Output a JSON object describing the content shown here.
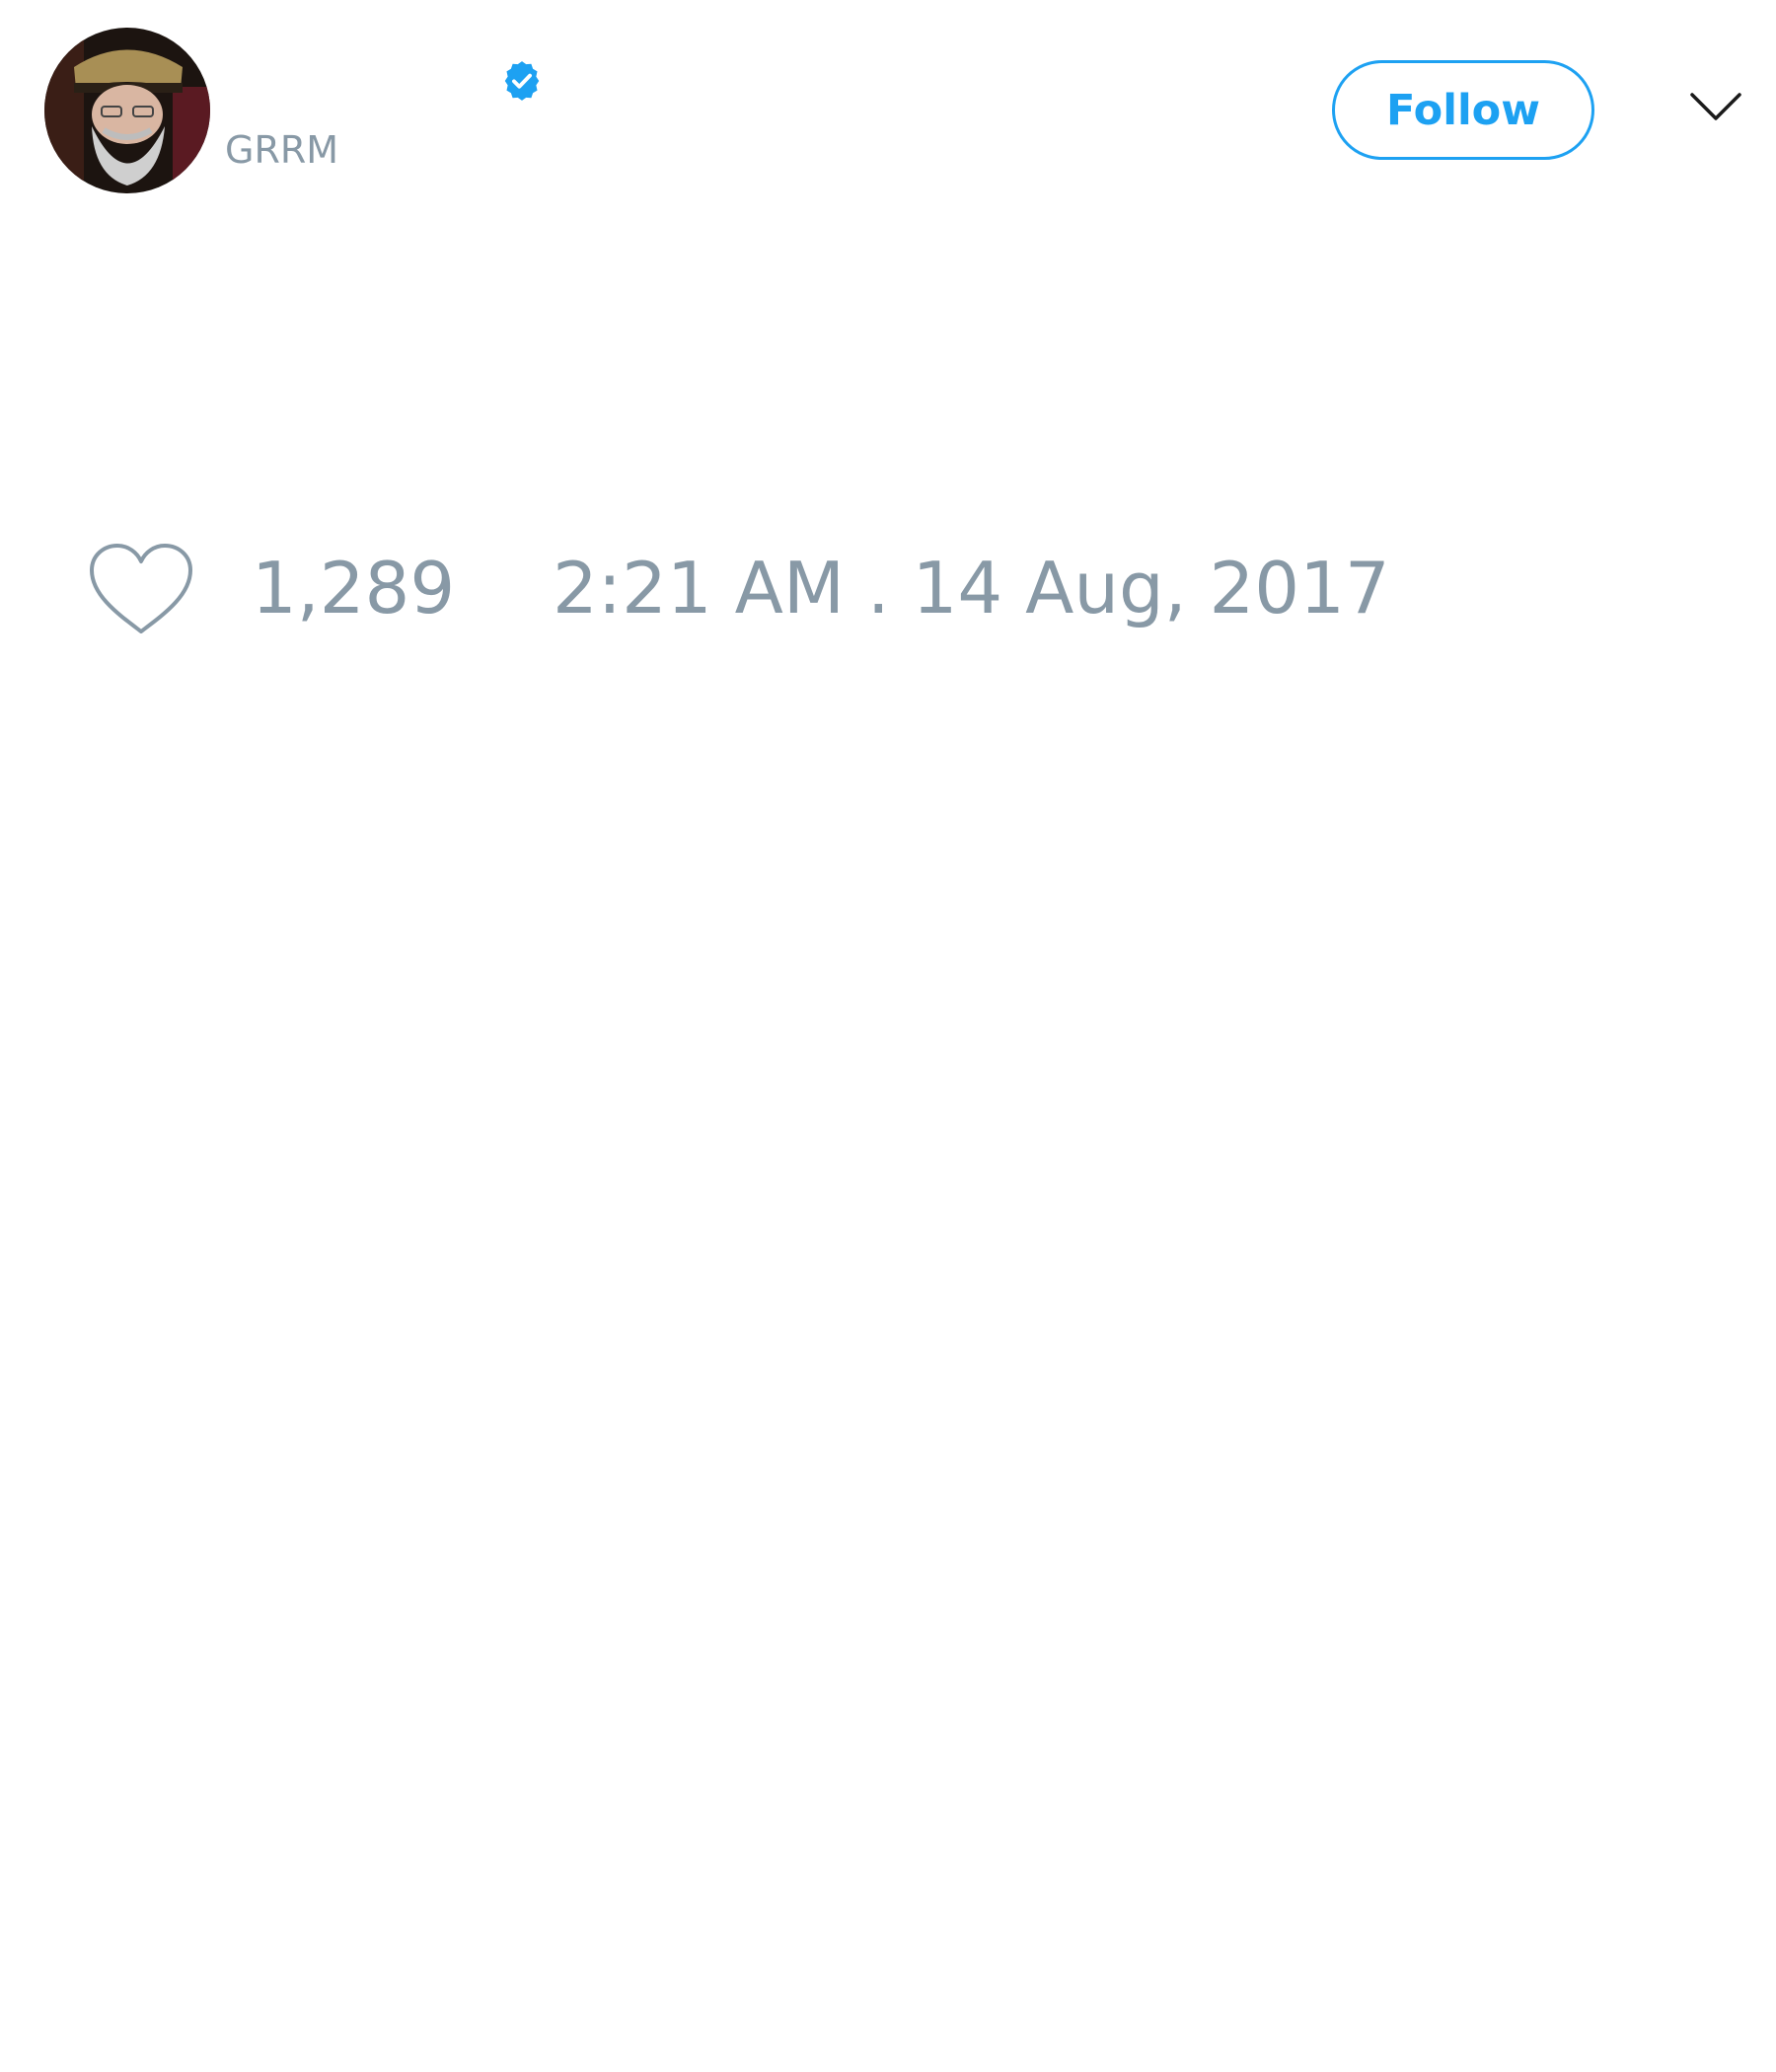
{
  "tweet": {
    "author": {
      "handle": "GRRM",
      "verified": true,
      "avatar_icon": "profile-photo"
    },
    "follow_label": "Follow",
    "menu_icon": "chevron-down-icon",
    "likes": {
      "icon": "heart-icon",
      "count": "1,289"
    },
    "timestamp": "2:21 AM . 14 Aug, 2017"
  },
  "colors": {
    "accent": "#1da1f2",
    "muted_text": "#8899a6",
    "background": "#ffffff"
  }
}
